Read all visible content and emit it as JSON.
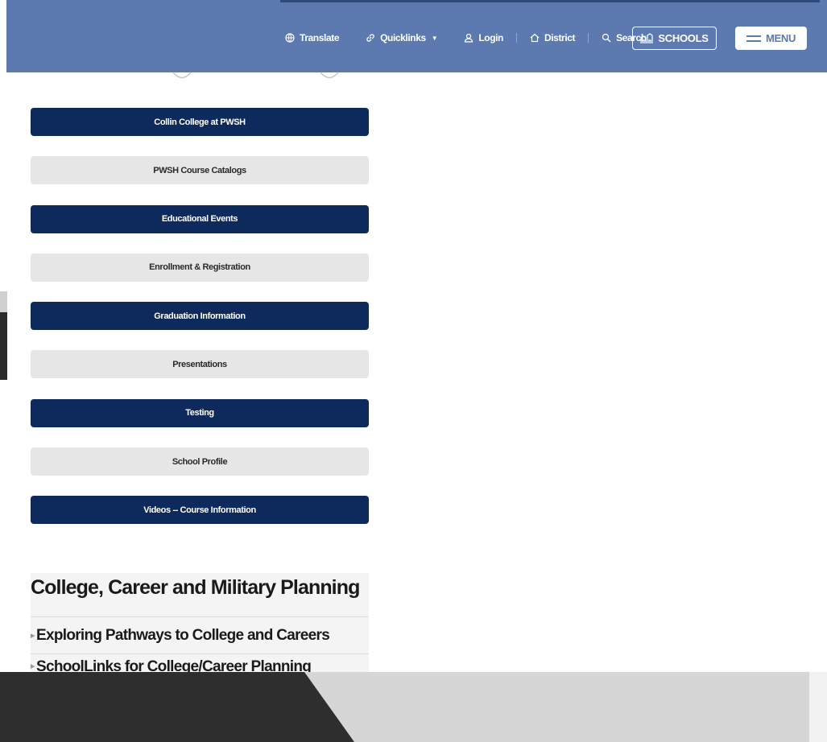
{
  "header": {
    "nav": [
      {
        "label": "Translate",
        "icon": "translate-icon"
      },
      {
        "label": "Quicklinks",
        "icon": "link-icon",
        "dropdown": true
      },
      {
        "label": "Login",
        "icon": "user-icon"
      },
      {
        "label": "District",
        "icon": "home-icon"
      },
      {
        "label": "Search",
        "icon": "search-icon"
      }
    ],
    "schools_label": "SCHOOLS",
    "menu_label": "MENU"
  },
  "links": [
    {
      "label": "Collin College at PWSH",
      "style": "dark"
    },
    {
      "label": "PWSH Course Catalogs",
      "style": "light"
    },
    {
      "label": "Educational Events",
      "style": "dark"
    },
    {
      "label": "Enrollment & Registration",
      "style": "light"
    },
    {
      "label": "Graduation Information",
      "style": "dark"
    },
    {
      "label": "Presentations",
      "style": "light"
    },
    {
      "label": "Testing",
      "style": "dark"
    },
    {
      "label": "School Profile",
      "style": "light"
    },
    {
      "label": "Videos -- Course Information",
      "style": "dark"
    }
  ],
  "planning": {
    "title": "College, Career and Military Planning",
    "items": [
      {
        "label": "Exploring Pathways to College and Careers"
      },
      {
        "label": "SchoolLinks for College/Career Planning"
      }
    ]
  },
  "colors": {
    "header_bg": "#5c7aaf",
    "dark_button": "#0e2a5c",
    "light_button": "#e6e6e6"
  }
}
